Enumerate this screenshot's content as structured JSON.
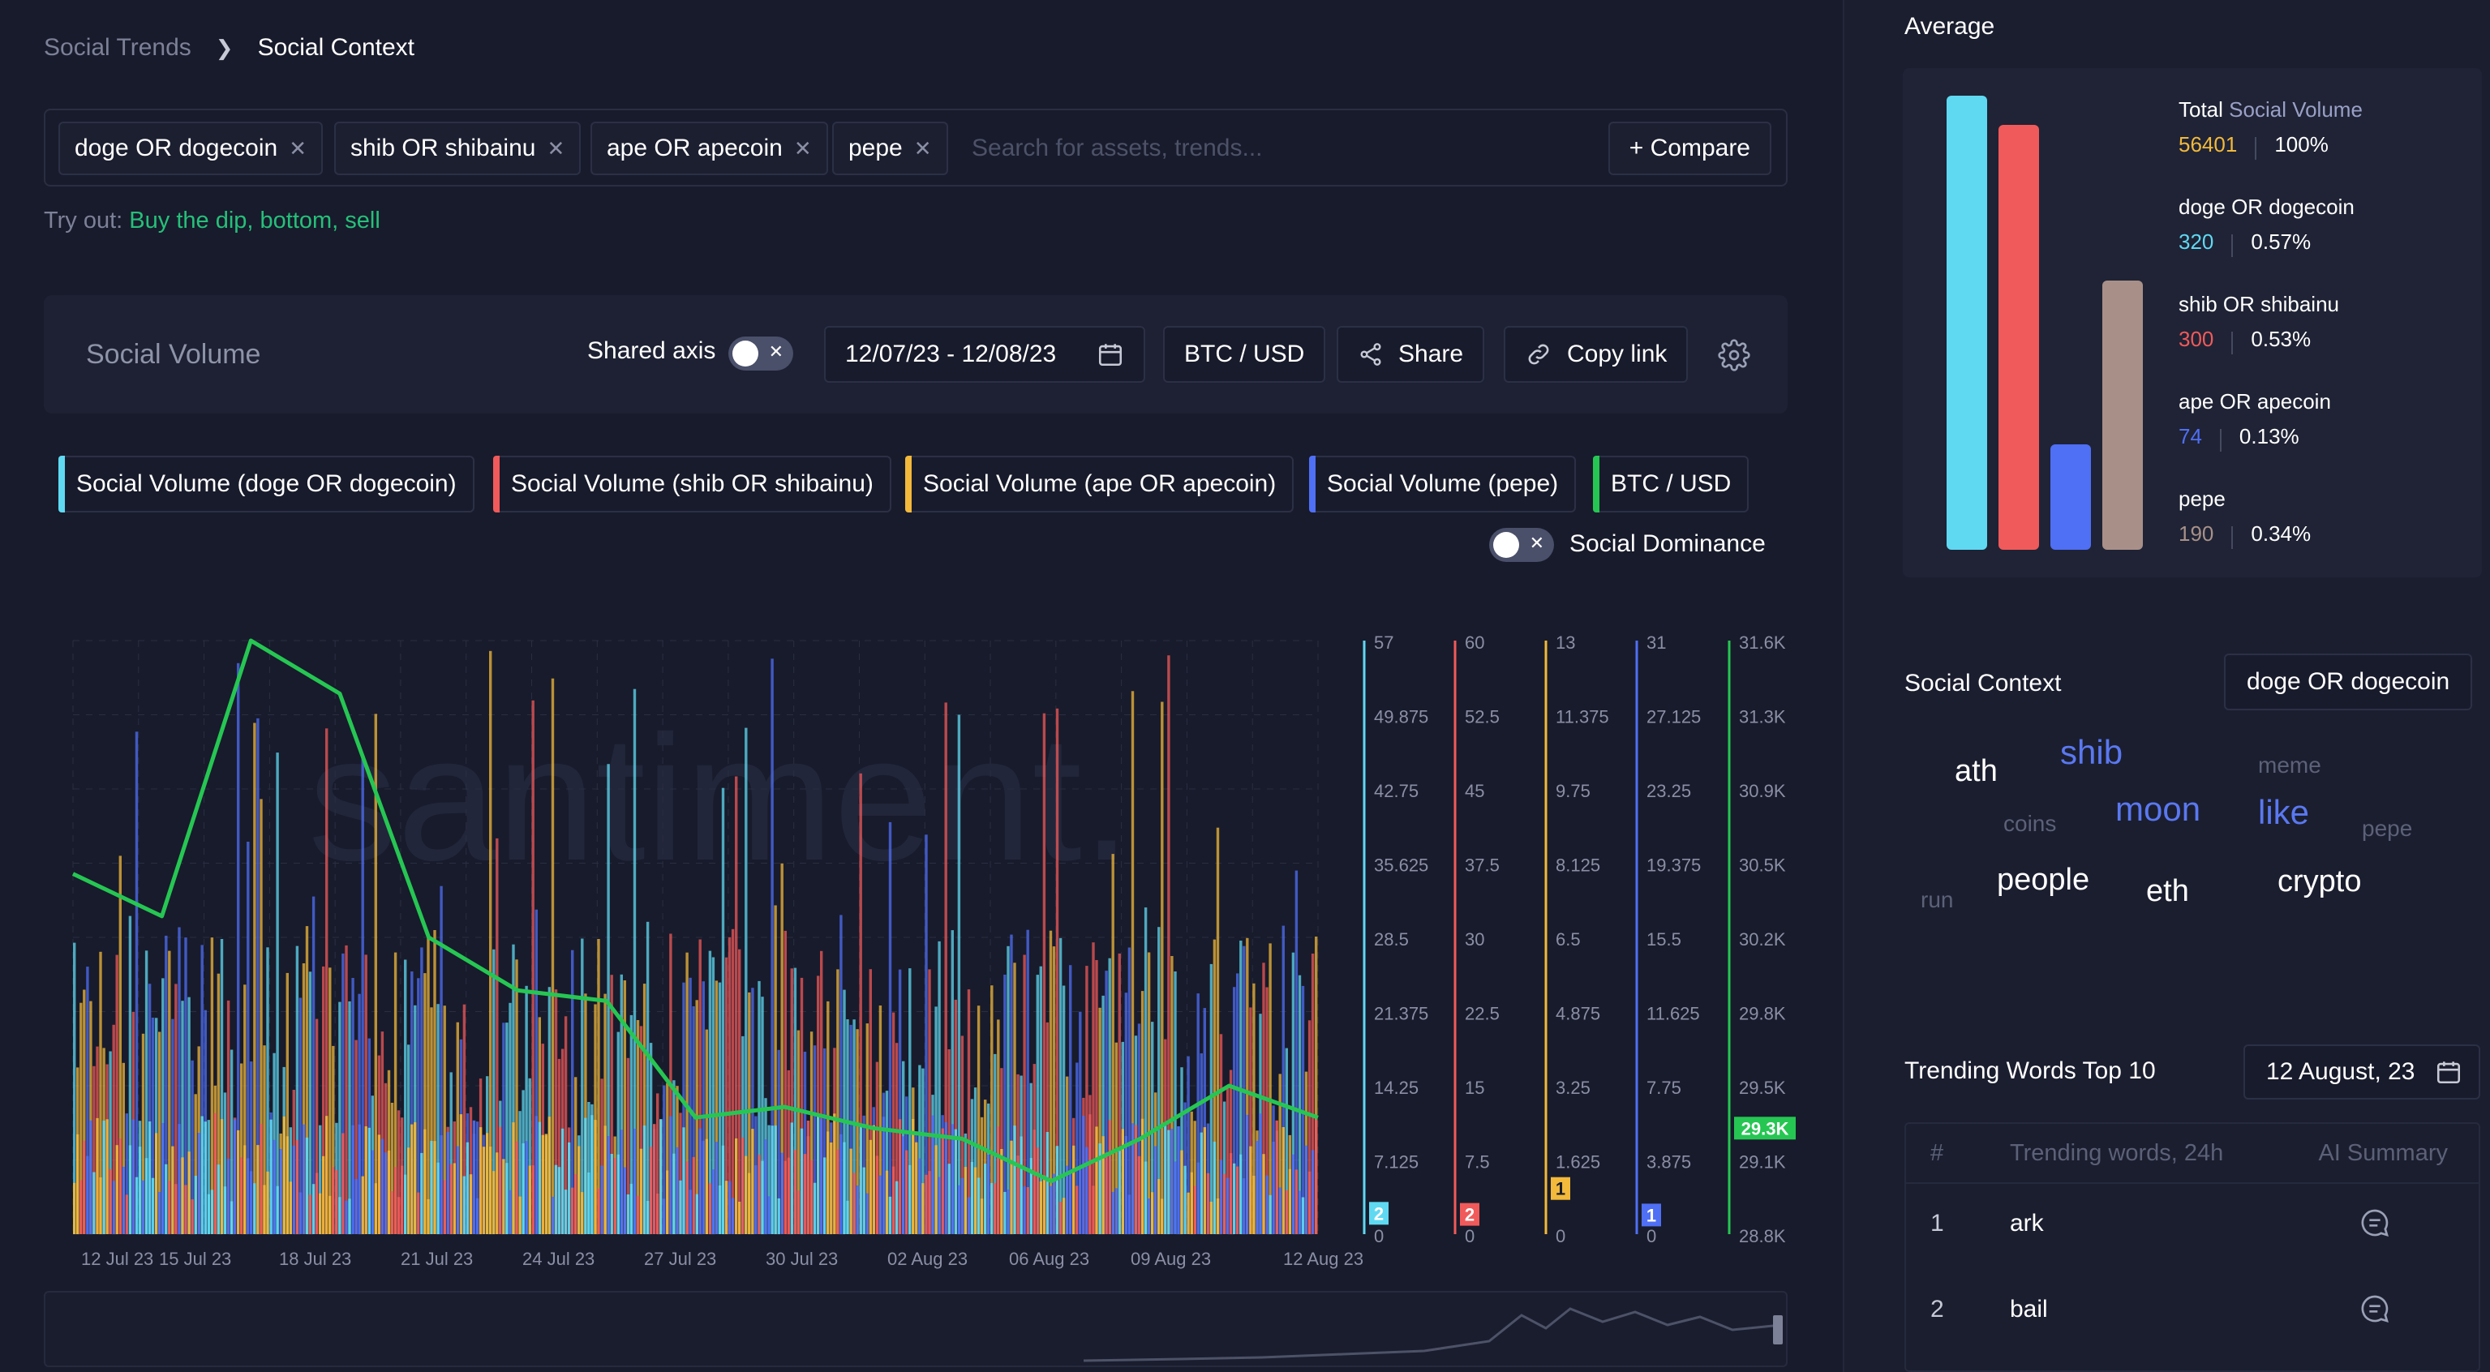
{
  "breadcrumb": {
    "previous": "Social Trends",
    "current": "Social Context"
  },
  "search": {
    "chips": [
      {
        "label": "doge OR dogecoin"
      },
      {
        "label": "shib OR shibainu"
      },
      {
        "label": "ape OR apecoin"
      },
      {
        "label": "pepe"
      }
    ],
    "placeholder": "Search for assets, trends...",
    "compare_label": "+ Compare"
  },
  "try_out": {
    "prefix": "Try out:",
    "suggestions": "Buy the dip, bottom, sell"
  },
  "toolbar": {
    "title": "Social Volume",
    "shared_axis_label": "Shared axis",
    "shared_axis_on": false,
    "date_range": "12/07/23 - 12/08/23",
    "pair": "BTC / USD",
    "share_label": "Share",
    "copy_link_label": "Copy link"
  },
  "metrics": [
    {
      "label": "Social Volume (doge OR dogecoin)",
      "color": "#5fd9f2"
    },
    {
      "label": "Social Volume (shib OR shibainu)",
      "color": "#f05a5a"
    },
    {
      "label": "Social Volume (ape OR apecoin)",
      "color": "#f2b93b"
    },
    {
      "label": "Social Volume (pepe)",
      "color": "#4f6ff5"
    },
    {
      "label": "BTC / USD",
      "color": "#26c653"
    }
  ],
  "social_dominance": {
    "label": "Social Dominance",
    "on": false
  },
  "watermark": "santiment.",
  "chart_data": {
    "type": "bar",
    "x_ticks": [
      "12 Jul 23",
      "15 Jul 23",
      "18 Jul 23",
      "21 Jul 23",
      "24 Jul 23",
      "27 Jul 23",
      "30 Jul 23",
      "02 Aug 23",
      "06 Aug 23",
      "09 Aug 23",
      "12 Aug 23"
    ],
    "axes": [
      {
        "series": "Social Volume (doge OR dogecoin)",
        "color": "#5fd9f2",
        "ticks": [
          "57",
          "49.875",
          "42.75",
          "35.625",
          "28.5",
          "21.375",
          "14.25",
          "7.125",
          "0"
        ],
        "current": "2",
        "ylim": [
          0,
          57
        ]
      },
      {
        "series": "Social Volume (shib OR shibainu)",
        "color": "#f05a5a",
        "ticks": [
          "60",
          "52.5",
          "45",
          "37.5",
          "30",
          "22.5",
          "15",
          "7.5",
          "0"
        ],
        "current": "2",
        "ylim": [
          0,
          60
        ]
      },
      {
        "series": "Social Volume (ape OR apecoin)",
        "color": "#f2b93b",
        "ticks": [
          "13",
          "11.375",
          "9.75",
          "8.125",
          "6.5",
          "4.875",
          "3.25",
          "1.625",
          "0"
        ],
        "current": "1",
        "ylim": [
          0,
          13
        ]
      },
      {
        "series": "Social Volume (pepe)",
        "color": "#4f6ff5",
        "ticks": [
          "31",
          "27.125",
          "23.25",
          "19.375",
          "15.5",
          "11.625",
          "7.75",
          "3.875",
          "0"
        ],
        "current": "1",
        "ylim": [
          0,
          31
        ]
      },
      {
        "series": "BTC / USD",
        "color": "#26c653",
        "ticks": [
          "31.6K",
          "31.3K",
          "30.9K",
          "30.5K",
          "30.2K",
          "29.8K",
          "29.5K",
          "29.1K",
          "28.8K"
        ],
        "current": "29.3K",
        "ylim": [
          28800,
          31600
        ]
      }
    ],
    "series": [
      {
        "name": "BTC / USD",
        "type": "line",
        "x": [
          "12 Jul 23",
          "13 Jul 23",
          "14 Jul 23",
          "15 Jul 23",
          "17 Jul 23",
          "19 Jul 23",
          "21 Jul 23",
          "24 Jul 23",
          "27 Jul 23",
          "30 Jul 23",
          "02 Aug 23",
          "05 Aug 23",
          "08 Aug 23",
          "10 Aug 23",
          "12 Aug 23"
        ],
        "values": [
          30500,
          30300,
          31600,
          31350,
          30200,
          29950,
          29900,
          29350,
          29400,
          29300,
          29250,
          29050,
          29250,
          29500,
          29350
        ]
      }
    ]
  },
  "side": {
    "average_title": "Average",
    "average": {
      "total_label": "Total",
      "total_metric": "Social Volume",
      "total_value": "56401",
      "total_pct": "100%",
      "items": [
        {
          "label": "doge OR dogecoin",
          "value": "320",
          "pct": "0.57%",
          "color": "#5fd9f2"
        },
        {
          "label": "shib OR shibainu",
          "value": "300",
          "pct": "0.53%",
          "color": "#f05a5a"
        },
        {
          "label": "ape OR apecoin",
          "value": "74",
          "pct": "0.13%",
          "color": "#4f6ff5"
        },
        {
          "label": "pepe",
          "value": "190",
          "pct": "0.34%",
          "color": "#a89089"
        }
      ]
    },
    "social_context_title": "Social Context",
    "social_context_select": "doge OR dogecoin",
    "words": [
      {
        "text": "ath",
        "color": "#ffffff",
        "size": 38
      },
      {
        "text": "shib",
        "color": "#5a78f0",
        "size": 42
      },
      {
        "text": "meme",
        "color": "#5c6178",
        "size": 28
      },
      {
        "text": "coins",
        "color": "#5c6178",
        "size": 28
      },
      {
        "text": "moon",
        "color": "#5a78f0",
        "size": 42
      },
      {
        "text": "like",
        "color": "#5a78f0",
        "size": 42
      },
      {
        "text": "pepe",
        "color": "#5c6178",
        "size": 28
      },
      {
        "text": "run",
        "color": "#5c6178",
        "size": 28
      },
      {
        "text": "people",
        "color": "#ffffff",
        "size": 38
      },
      {
        "text": "eth",
        "color": "#ffffff",
        "size": 38
      },
      {
        "text": "crypto",
        "color": "#ffffff",
        "size": 38
      }
    ],
    "trending_title": "Trending Words Top 10",
    "trending_date": "12 August, 23",
    "table": {
      "headers": [
        "#",
        "Trending words, 24h",
        "AI Summary"
      ],
      "rows": [
        {
          "rank": "1",
          "word": "ark"
        },
        {
          "rank": "2",
          "word": "bail"
        }
      ]
    }
  }
}
